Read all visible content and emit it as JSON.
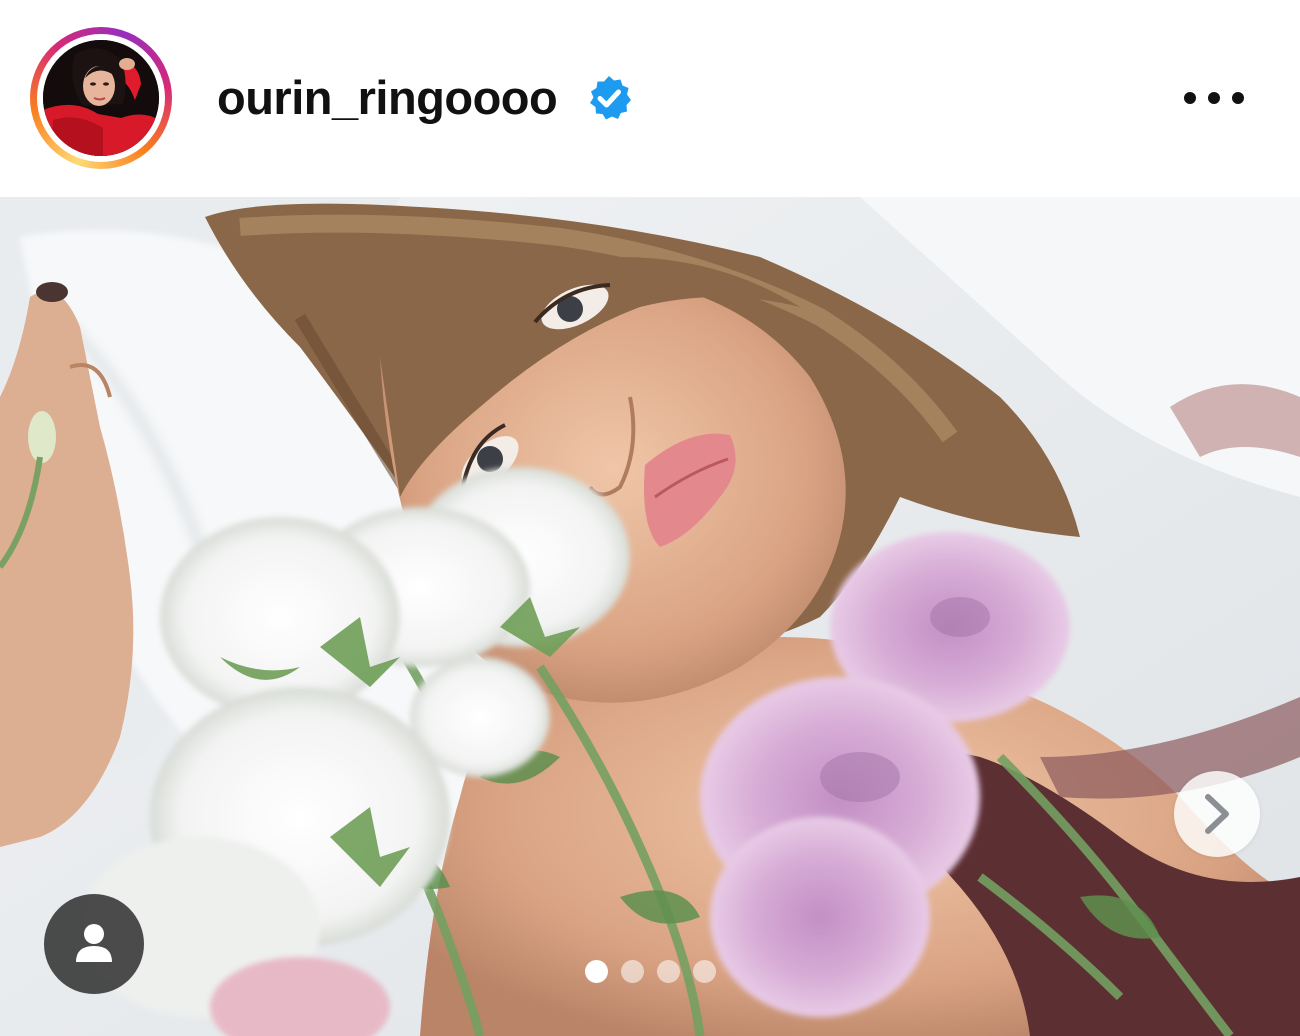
{
  "post": {
    "username": "ourin_ringoooo",
    "verified": true,
    "avatar_alt": "profile picture",
    "more_icon": "ellipsis-icon"
  },
  "carousel": {
    "slide_count": 4,
    "active_index": 0,
    "next_icon": "chevron-right-icon",
    "tag_icon": "user-tag-icon"
  },
  "colors": {
    "username": "#111111",
    "verified_badge": "#1d9bf0",
    "ring_start": "#feda75",
    "ring_end": "#d62976"
  }
}
